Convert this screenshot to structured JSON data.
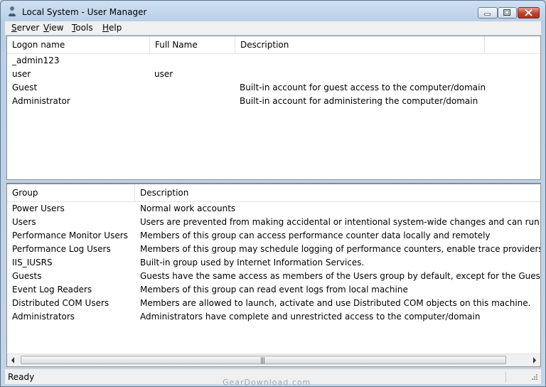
{
  "window": {
    "title": "Local System - User Manager"
  },
  "menu": [
    {
      "accel": "S",
      "rest": "erver"
    },
    {
      "accel": "V",
      "rest": "iew"
    },
    {
      "accel": "T",
      "rest": "ools"
    },
    {
      "accel": "H",
      "rest": "elp"
    }
  ],
  "users": {
    "columns": [
      "Logon name",
      "Full Name",
      "Description"
    ],
    "rows": [
      [
        "_admin123",
        "",
        ""
      ],
      [
        "user",
        "user",
        ""
      ],
      [
        "Guest",
        "",
        "Built-in account for guest access to the computer/domain"
      ],
      [
        "Administrator",
        "",
        "Built-in account for administering the computer/domain"
      ]
    ]
  },
  "groups": {
    "columns": [
      "Group",
      "Description"
    ],
    "rows": [
      [
        "Power Users",
        "Normal work accounts"
      ],
      [
        "Users",
        "Users are prevented from making accidental or intentional system-wide changes and can run most applicat"
      ],
      [
        "Performance Monitor Users",
        "Members of this group can access performance counter data locally and remotely"
      ],
      [
        "Performance Log Users",
        "Members of this group may schedule logging of performance counters, enable trace providers, and collect"
      ],
      [
        "IIS_IUSRS",
        "Built-in group used by Internet Information Services."
      ],
      [
        "Guests",
        "Guests have the same access as members of the Users group by default, except for the Guest account which"
      ],
      [
        "Event Log Readers",
        "Members of this group can read event logs from local machine"
      ],
      [
        "Distributed COM Users",
        "Members are allowed to launch, activate and use Distributed COM objects on this machine."
      ],
      [
        "Administrators",
        "Administrators have complete and unrestricted access to the computer/domain"
      ]
    ]
  },
  "status": {
    "text": "Ready"
  },
  "watermark": "GearDownload.com",
  "icons": [
    "app-icon",
    "minimize-icon",
    "maximize-icon",
    "close-icon",
    "scroll-left-icon",
    "scroll-right-icon",
    "size-grip-icon"
  ]
}
